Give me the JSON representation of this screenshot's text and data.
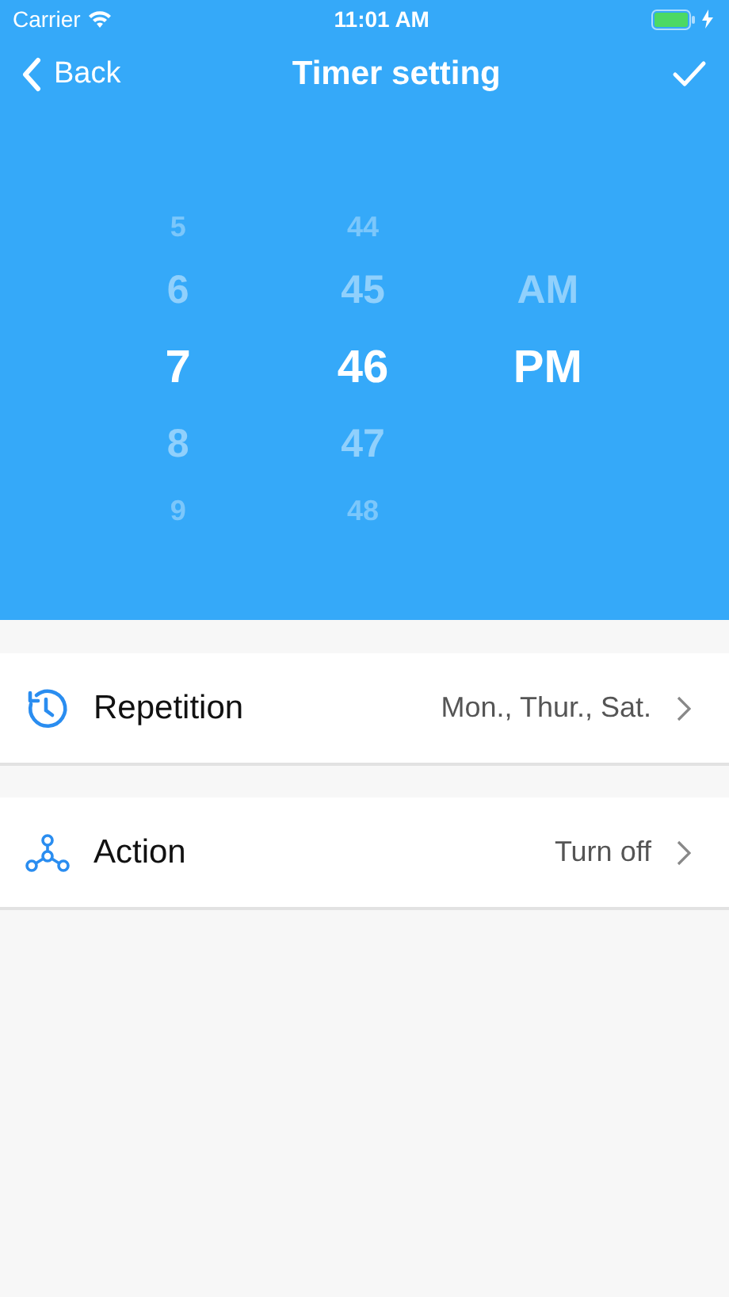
{
  "status_bar": {
    "carrier": "Carrier",
    "time": "11:01 AM"
  },
  "nav": {
    "back": "Back",
    "title": "Timer setting"
  },
  "picker": [
    {
      "items": [
        {
          "label": "5",
          "selected": false
        },
        {
          "label": "6",
          "selected": false
        },
        {
          "label": "7",
          "selected": true
        },
        {
          "label": "8",
          "selected": false
        },
        {
          "label": "9",
          "selected": false
        }
      ]
    },
    {
      "items": [
        {
          "label": "44",
          "selected": false
        },
        {
          "label": "45",
          "selected": false
        },
        {
          "label": "46",
          "selected": true
        },
        {
          "label": "47",
          "selected": false
        },
        {
          "label": "48",
          "selected": false
        }
      ]
    },
    {
      "items": [
        {
          "label": "AM",
          "selected": false
        },
        {
          "label": "PM",
          "selected": true
        }
      ]
    }
  ],
  "settings": [
    {
      "kind": "repeat",
      "label": "Repetition",
      "value": "Mon., Thur., Sat."
    },
    {
      "kind": "action",
      "label": "Action",
      "value": "Turn off"
    }
  ]
}
